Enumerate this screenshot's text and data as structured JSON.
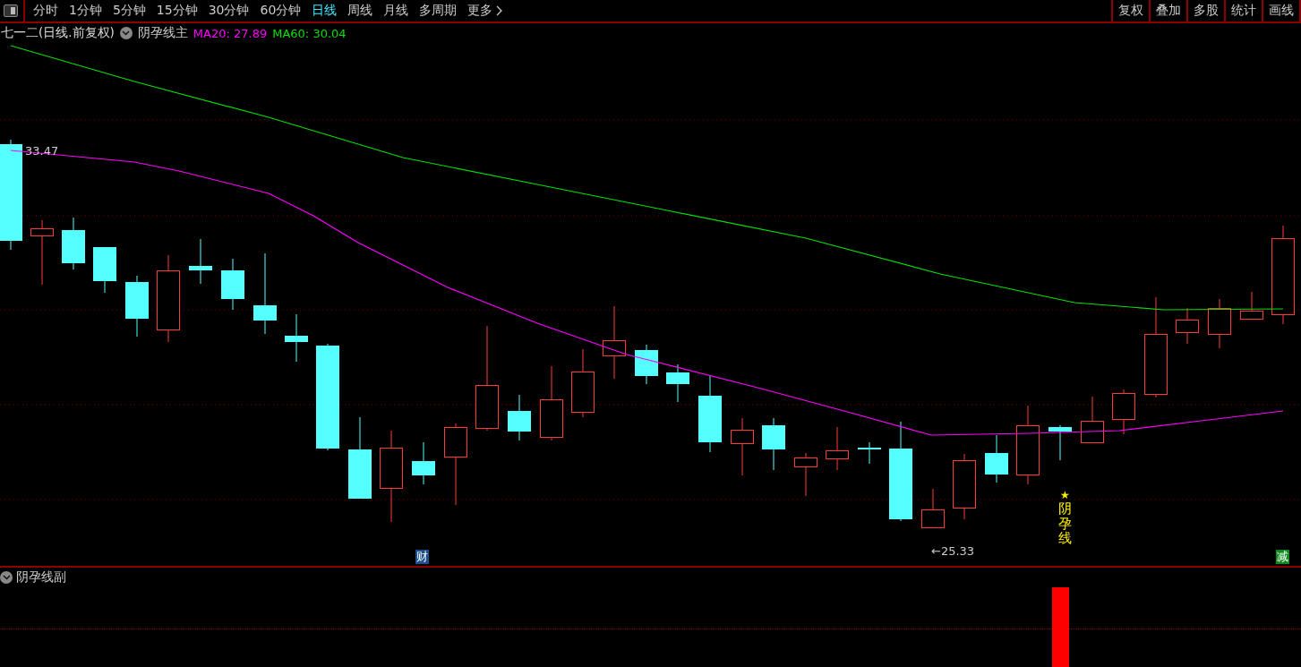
{
  "toolbar": {
    "periods": [
      {
        "label": "分时",
        "selected": false
      },
      {
        "label": "1分钟",
        "selected": false
      },
      {
        "label": "5分钟",
        "selected": false
      },
      {
        "label": "15分钟",
        "selected": false
      },
      {
        "label": "30分钟",
        "selected": false
      },
      {
        "label": "60分钟",
        "selected": false
      },
      {
        "label": "日线",
        "selected": true
      },
      {
        "label": "周线",
        "selected": false
      },
      {
        "label": "月线",
        "selected": false
      },
      {
        "label": "多周期",
        "selected": false
      }
    ],
    "more": "更多",
    "buttons": [
      "复权",
      "叠加",
      "多股",
      "统计",
      "画线"
    ]
  },
  "legend": {
    "title": "七一二(日线.前复权)",
    "indicator": "阴孕线主",
    "averages": [
      {
        "label": "MA20: 27.89",
        "color": "#ff00ff"
      },
      {
        "label": "MA60: 30.04",
        "color": "#00e000"
      }
    ]
  },
  "chart": {
    "high_label": "33.47",
    "low_label": "←25.33",
    "signal": {
      "star": "★",
      "text": "阴孕线"
    },
    "badges": [
      {
        "text": "财",
        "color": "#1c4f8c"
      },
      {
        "text": "减",
        "color": "#0f8a1e"
      }
    ]
  },
  "sub_pane": {
    "title": "阴孕线副"
  }
}
